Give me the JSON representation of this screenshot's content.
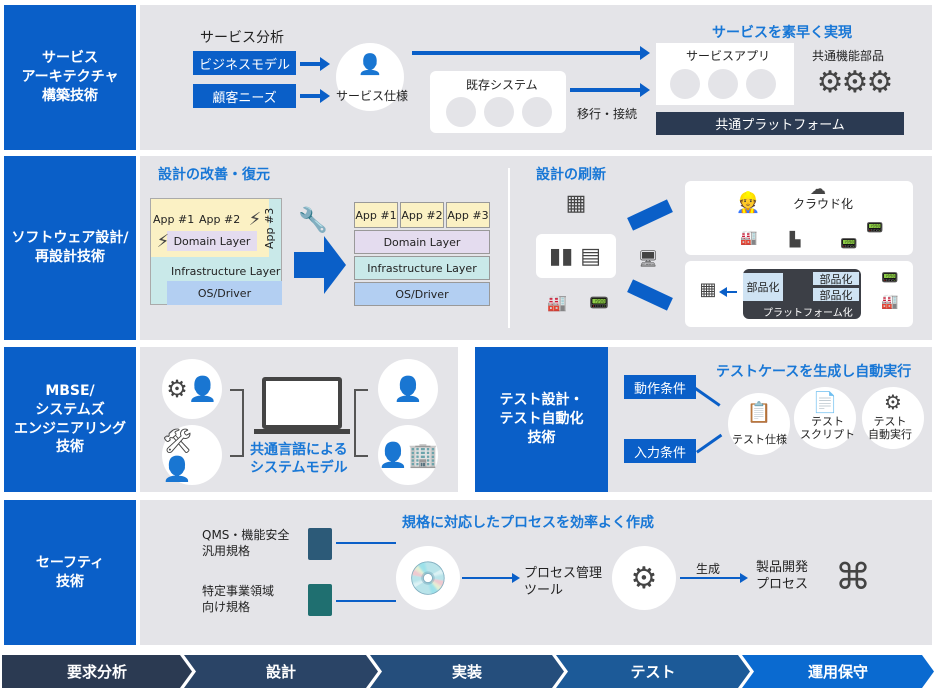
{
  "rows": {
    "r1": {
      "label": "サービス\nアーキテクチャ\n構築技術",
      "analysis": "サービス分析",
      "business_model": "ビジネスモデル",
      "customer_needs": "顧客ニーズ",
      "service_spec": "サービス仕様",
      "existing": "既存システム",
      "migrate": "移行・接続",
      "title": "サービスを素早く実現",
      "service_app": "サービスアプリ",
      "common_parts": "共通機能部品",
      "platform": "共通プラットフォーム"
    },
    "r2": {
      "label": "ソフトウェア設計/\n再設計技術",
      "improve_title": "設計の改善・復元",
      "renew_title": "設計の刷新",
      "app1": "App #1",
      "app2": "App #2",
      "app3": "App #3",
      "domain": "Domain Layer",
      "infra": "Infrastructure Layer",
      "os": "OS/Driver",
      "cloud": "クラウド化",
      "parts": "部品化",
      "platform": "プラットフォーム化"
    },
    "r3": {
      "label": "MBSE/\nシステムズ\nエンジニアリング\n技術",
      "model": "共通言語による\nシステムモデル",
      "test_label": "テスト設計・\nテスト自動化\n技術",
      "test_title": "テストケースを生成し自動実行",
      "cond1": "動作条件",
      "cond2": "入力条件",
      "spec": "テスト仕様",
      "script": "テスト\nスクリプト",
      "auto": "テスト\n自動実行"
    },
    "r4": {
      "label": "セーフティ\n技術",
      "title": "規格に対応したプロセスを効率よく作成",
      "std1": "QMS・機能安全\n汎用規格",
      "std2": "特定事業領域\n向け規格",
      "tool": "プロセス管理\nツール",
      "generate": "生成",
      "process": "製品開発\nプロセス"
    }
  },
  "phases": [
    "要求分析",
    "設計",
    "実装",
    "テスト",
    "運用保守"
  ],
  "colors": {
    "accent": "#0a5fc8",
    "panel": "#e4e4e8",
    "phase_dark": "#2b3a52"
  }
}
